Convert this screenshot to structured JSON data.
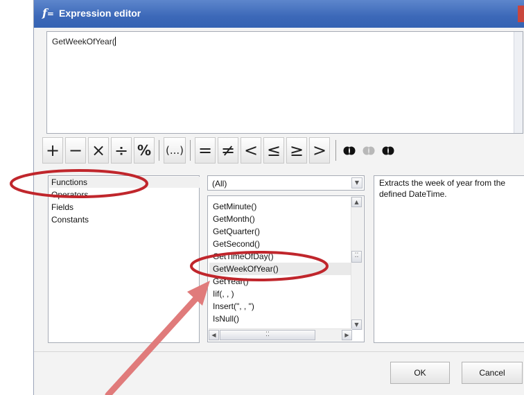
{
  "window": {
    "title": "Expression editor",
    "title_icon": "fx-icon"
  },
  "expression": {
    "value": "GetWeekOfYear("
  },
  "operators": {
    "plus": "+",
    "minus": "−",
    "multiply": "×",
    "divide": "÷",
    "modulo": "%",
    "parentheses": "(...)",
    "equal": "=",
    "not_equal": "≠",
    "less": "<",
    "less_equal": "≤",
    "greater_equal": "≥",
    "greater": ">"
  },
  "categories": {
    "items": [
      "Functions",
      "Operators",
      "Fields",
      "Constants"
    ],
    "selected": "Functions"
  },
  "filter": {
    "value": "(All)"
  },
  "functions": {
    "items": [
      "GetMinute()",
      "GetMonth()",
      "GetQuarter()",
      "GetSecond()",
      "GetTimeOfDay()",
      "GetWeekOfYear()",
      "GetYear()",
      "Iif(, , )",
      "Insert(\", , \")",
      "IsNull()"
    ],
    "selected": "GetWeekOfYear()"
  },
  "description": {
    "text": "Extracts the week of year from the defined DateTime."
  },
  "footer": {
    "ok_label": "OK",
    "cancel_label": "Cancel"
  },
  "annotation": {
    "highlight_color": "#c0262c",
    "arrow_color": "#e07b7b"
  }
}
